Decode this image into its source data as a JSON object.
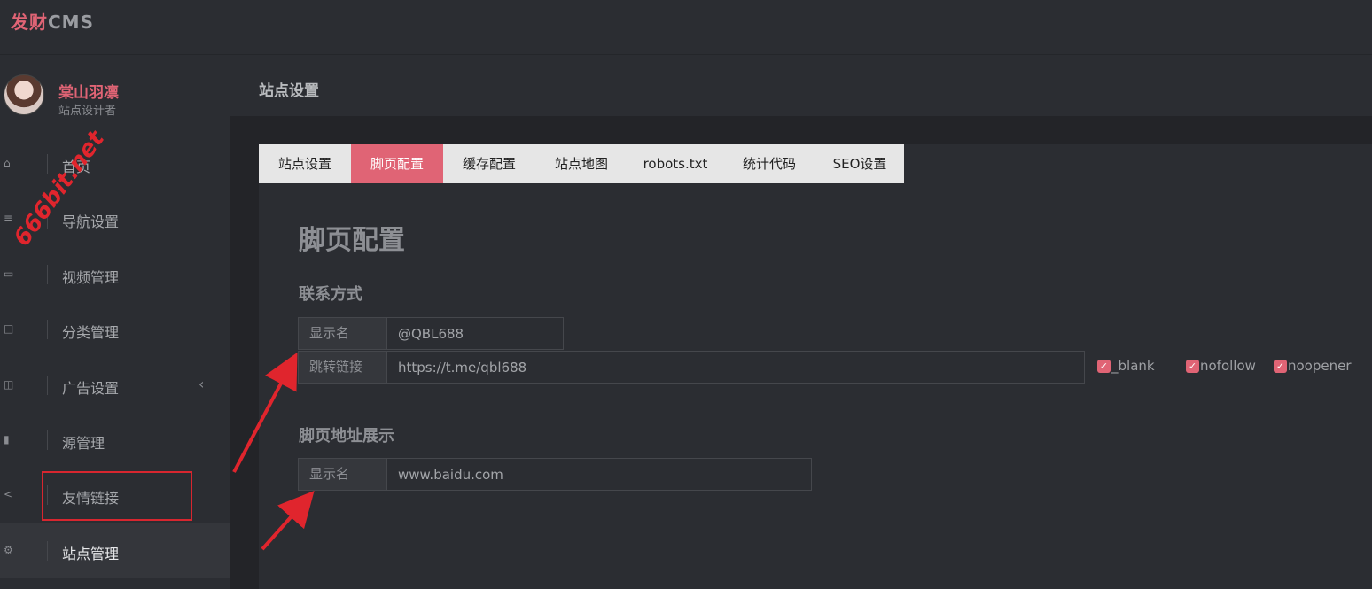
{
  "app": {
    "logo_a": "发财",
    "logo_b": "CMS"
  },
  "profile": {
    "name": "棠山羽凛",
    "role": "站点设计者"
  },
  "sidebar": {
    "items": [
      {
        "label": "首页",
        "icon": "home-icon"
      },
      {
        "label": "导航设置",
        "icon": "sliders-icon"
      },
      {
        "label": "视频管理",
        "icon": "video-icon"
      },
      {
        "label": "分类管理",
        "icon": "category-icon"
      },
      {
        "label": "广告设置",
        "icon": "book-icon",
        "chevron": "‹"
      },
      {
        "label": "源管理",
        "icon": "bar-chart-icon"
      },
      {
        "label": "友情链接",
        "icon": "share-icon"
      },
      {
        "label": "站点管理",
        "icon": "gear-icon",
        "active": true
      }
    ]
  },
  "header": {
    "title": "站点设置"
  },
  "tabs": [
    "站点设置",
    "脚页配置",
    "缓存配置",
    "站点地图",
    "robots.txt",
    "统计代码",
    "SEO设置"
  ],
  "active_tab": 1,
  "page": {
    "title": "脚页配置"
  },
  "contact": {
    "title": "联系方式",
    "name_label": "显示名",
    "name_value": "@QBL688",
    "link_label": "跳转链接",
    "link_value": "https://t.me/qbl688",
    "options": [
      "_blank",
      "nofollow",
      "noopener"
    ]
  },
  "footer_addr": {
    "title": "脚页地址展示",
    "name_label": "显示名",
    "name_value": "www.baidu.com"
  },
  "watermark": "666bit.net",
  "colors": {
    "accent": "#e06475",
    "annotation": "#e0252d"
  }
}
